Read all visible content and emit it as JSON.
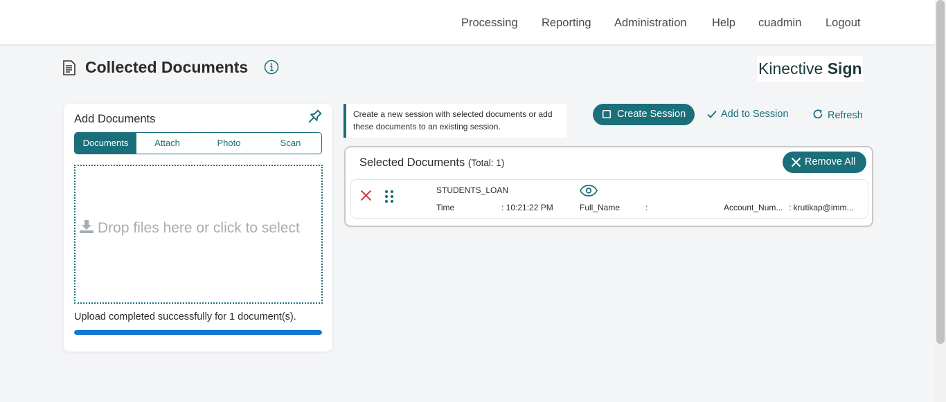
{
  "nav": {
    "processing": "Processing",
    "reporting": "Reporting",
    "administration": "Administration",
    "help": "Help",
    "user": "cuadmin",
    "logout": "Logout"
  },
  "page": {
    "title": "Collected Documents",
    "brand_regular": "Kinective",
    "brand_bold": "Sign"
  },
  "add_documents": {
    "title": "Add Documents",
    "tabs": [
      "Documents",
      "Attach",
      "Photo",
      "Scan"
    ],
    "active_tab": "Documents",
    "drop_text": "Drop files here or click to select",
    "upload_message": "Upload completed successfully for 1 document(s).",
    "progress_percent": 100
  },
  "session": {
    "note": "Create a new session with selected documents or add these documents to an existing session.",
    "create_label": "Create Session",
    "add_label": "Add to Session",
    "refresh_label": "Refresh"
  },
  "selected": {
    "title": "Selected Documents",
    "total_label": "(Total: 1)",
    "remove_all_label": "Remove All",
    "documents": [
      {
        "name": "STUDENTS_LOAN",
        "time_label": "Time",
        "time_value": ": 10:21:22 PM",
        "fullname_label": "Full_Name",
        "fullname_value": ":",
        "account_label": "Account_Num...",
        "account_value": ": krutikap@imm..."
      }
    ]
  },
  "colors": {
    "accent": "#1b6f7a",
    "progress": "#1378d0",
    "danger": "#d9363e"
  },
  "icons": [
    "document-icon",
    "info-icon",
    "pin-icon",
    "download-icon",
    "square-icon",
    "check-icon",
    "refresh-icon",
    "close-icon",
    "drag-handle-icon",
    "eye-icon"
  ]
}
